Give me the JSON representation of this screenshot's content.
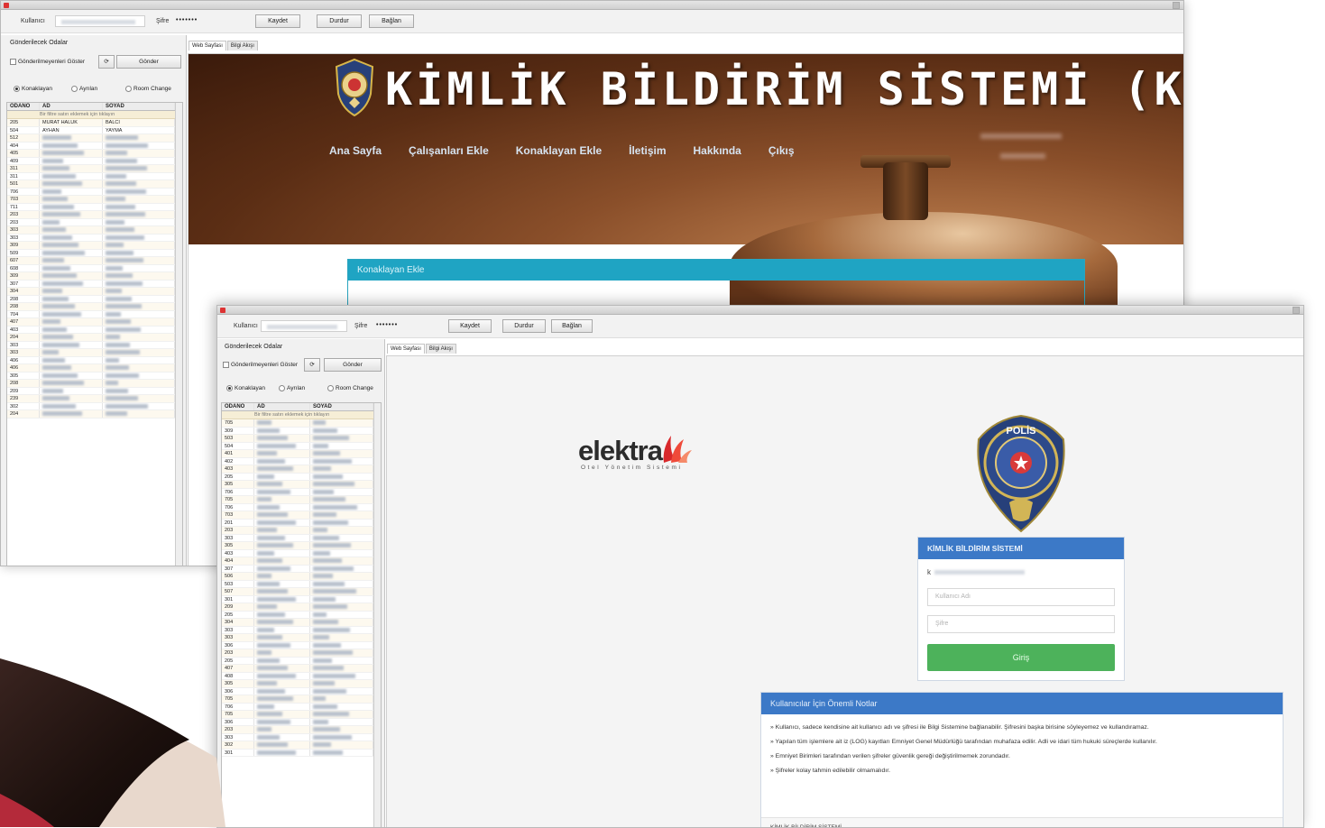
{
  "window1": {
    "title": "",
    "toolbar": {
      "user_label": "Kullanıcı",
      "password_label": "Şifre",
      "password_value": "•••••••",
      "buttons": [
        "Kaydet",
        "Durdur",
        "Bağlan"
      ]
    },
    "side": {
      "section_title": "Gönderilecek Odalar",
      "checkbox_label": "Gönderilmeyenleri Göster",
      "button_label": "Gönder",
      "radios": [
        "Konaklayan",
        "Ayrılan",
        "Room Change"
      ],
      "grid": {
        "columns": [
          "ODANO",
          "AD",
          "SOYAD"
        ],
        "filter_text": "Bir filtre satırı eklemek için tıklayın",
        "rows": [
          {
            "room": "205",
            "ad": "MURAT HALUK",
            "soyad": "BALCI"
          },
          {
            "room": "504",
            "ad": "AYHAN",
            "soyad": "YAYMA"
          },
          {
            "room": "512"
          },
          {
            "room": "404"
          },
          {
            "room": "405"
          },
          {
            "room": "409"
          },
          {
            "room": "311"
          },
          {
            "room": "311"
          },
          {
            "room": "501"
          },
          {
            "room": "706"
          },
          {
            "room": "703"
          },
          {
            "room": "711"
          },
          {
            "room": "203"
          },
          {
            "room": "203"
          },
          {
            "room": "303"
          },
          {
            "room": "303"
          },
          {
            "room": "309"
          },
          {
            "room": "509"
          },
          {
            "room": "607"
          },
          {
            "room": "608"
          },
          {
            "room": "309"
          },
          {
            "room": "307"
          },
          {
            "room": "304"
          },
          {
            "room": "208"
          },
          {
            "room": "208"
          },
          {
            "room": "704"
          },
          {
            "room": "407"
          },
          {
            "room": "403"
          },
          {
            "room": "204"
          },
          {
            "room": "303"
          },
          {
            "room": "303"
          },
          {
            "room": "406"
          },
          {
            "room": "406"
          },
          {
            "room": "305"
          },
          {
            "room": "208"
          },
          {
            "room": "209"
          },
          {
            "room": "239"
          },
          {
            "room": "302"
          },
          {
            "room": "204"
          }
        ]
      }
    },
    "tabs": [
      "Web Sayfası",
      "Bilgi Akışı"
    ],
    "web": {
      "title": "KİMLİK BİLDİRİM SİSTEMİ (KBS)",
      "nav": [
        "Ana Sayfa",
        "Çalışanları Ekle",
        "Konaklayan Ekle",
        "İletişim",
        "Hakkında",
        "Çıkış"
      ],
      "panel_title": "Konaklayan Ekle"
    }
  },
  "window2": {
    "title": "",
    "toolbar": {
      "user_label": "Kullanıcı",
      "password_label": "Şifre",
      "password_value": "•••••••",
      "buttons": [
        "Kaydet",
        "Durdur",
        "Bağlan"
      ]
    },
    "side": {
      "section_title": "Gönderilecek Odalar",
      "checkbox_label": "Gönderilmeyenleri Göster",
      "button_label": "Gönder",
      "radios": [
        "Konaklayan",
        "Ayrılan",
        "Room Change"
      ],
      "grid": {
        "columns": [
          "ODANO",
          "AD",
          "SOYAD"
        ],
        "filter_text": "Bir filtre satırı eklemek için tıklayın",
        "rows": [
          "705",
          "309",
          "503",
          "504",
          "401",
          "402",
          "403",
          "205",
          "305",
          "706",
          "705",
          "706",
          "703",
          "201",
          "203",
          "303",
          "305",
          "403",
          "404",
          "307",
          "506",
          "503",
          "507",
          "301",
          "209",
          "205",
          "304",
          "303",
          "303",
          "306",
          "203",
          "205",
          "407",
          "408",
          "305",
          "306",
          "705",
          "706",
          "705",
          "306",
          "203",
          "303",
          "302",
          "301"
        ]
      }
    },
    "tabs": [
      "Web Sayfası",
      "Bilgi Akışı"
    ],
    "web": {
      "logo_text": "elektra",
      "logo_sub": "Otel Yönetim Sistemi",
      "badge_text": "POLİS",
      "login": {
        "title": "KİMLİK BİLDİRİM SİSTEMİ",
        "username_placeholder": "Kullanıcı Adı",
        "password_placeholder": "Şifre",
        "button": "Giriş"
      },
      "notes": {
        "title": "Kullanıcılar İçin Önemli Notlar",
        "items": [
          "» Kullanıcı, sadece kendisine ait kullanıcı adı ve şifresi ile Bilgi Sistemine bağlanabilir. Şifresini başka birisine söyleyemez ve kullandıramaz.",
          "» Yapılan tüm işlemlere ait iz (LOG) kayıtları Emniyet Genel Müdürlüğü tarafından muhafaza edilir. Adli ve idari tüm hukuki süreçlerde kullanılır.",
          "» Emniyet Birimleri tarafından verilen şifreler güvenlik gereği değiştirilmemek zorundadır.",
          "» Şifreler kolay tahmin edilebilir olmamalıdır."
        ],
        "footer": "KİMLİK BİLDİRİM SİSTEMİ"
      }
    }
  },
  "colors": {
    "kbs_panel": "#1fa4c3",
    "login_header": "#3c79c7",
    "login_button": "#4db25b",
    "brand_red": "#e5373a"
  }
}
